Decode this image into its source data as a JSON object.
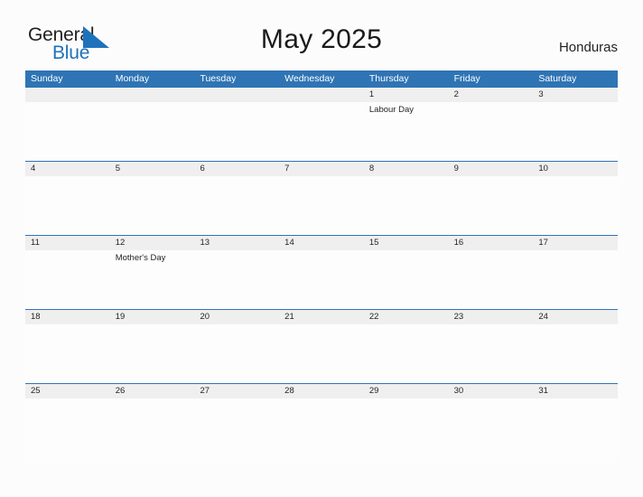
{
  "brand": {
    "name_part1": "General",
    "name_part2": "Blue",
    "flag_icon": "blue-triangle-flag-icon",
    "accent_color": "#1e72bb"
  },
  "header": {
    "title": "May 2025",
    "country": "Honduras"
  },
  "colors": {
    "header_bar": "#2f74b5",
    "date_band": "#efefef",
    "page_background": "#fcfcfd",
    "text": "#231f20"
  },
  "calendar": {
    "month": "May",
    "year": "2025",
    "weekday_headers": [
      "Sunday",
      "Monday",
      "Tuesday",
      "Wednesday",
      "Thursday",
      "Friday",
      "Saturday"
    ],
    "weeks": [
      {
        "days": [
          {
            "number": "",
            "events": []
          },
          {
            "number": "",
            "events": []
          },
          {
            "number": "",
            "events": []
          },
          {
            "number": "",
            "events": []
          },
          {
            "number": "1",
            "events": [
              "Labour Day"
            ]
          },
          {
            "number": "2",
            "events": []
          },
          {
            "number": "3",
            "events": []
          }
        ]
      },
      {
        "days": [
          {
            "number": "4",
            "events": []
          },
          {
            "number": "5",
            "events": []
          },
          {
            "number": "6",
            "events": []
          },
          {
            "number": "7",
            "events": []
          },
          {
            "number": "8",
            "events": []
          },
          {
            "number": "9",
            "events": []
          },
          {
            "number": "10",
            "events": []
          }
        ]
      },
      {
        "days": [
          {
            "number": "11",
            "events": []
          },
          {
            "number": "12",
            "events": [
              "Mother's Day"
            ]
          },
          {
            "number": "13",
            "events": []
          },
          {
            "number": "14",
            "events": []
          },
          {
            "number": "15",
            "events": []
          },
          {
            "number": "16",
            "events": []
          },
          {
            "number": "17",
            "events": []
          }
        ]
      },
      {
        "days": [
          {
            "number": "18",
            "events": []
          },
          {
            "number": "19",
            "events": []
          },
          {
            "number": "20",
            "events": []
          },
          {
            "number": "21",
            "events": []
          },
          {
            "number": "22",
            "events": []
          },
          {
            "number": "23",
            "events": []
          },
          {
            "number": "24",
            "events": []
          }
        ]
      },
      {
        "days": [
          {
            "number": "25",
            "events": []
          },
          {
            "number": "26",
            "events": []
          },
          {
            "number": "27",
            "events": []
          },
          {
            "number": "28",
            "events": []
          },
          {
            "number": "29",
            "events": []
          },
          {
            "number": "30",
            "events": []
          },
          {
            "number": "31",
            "events": []
          }
        ]
      }
    ]
  }
}
